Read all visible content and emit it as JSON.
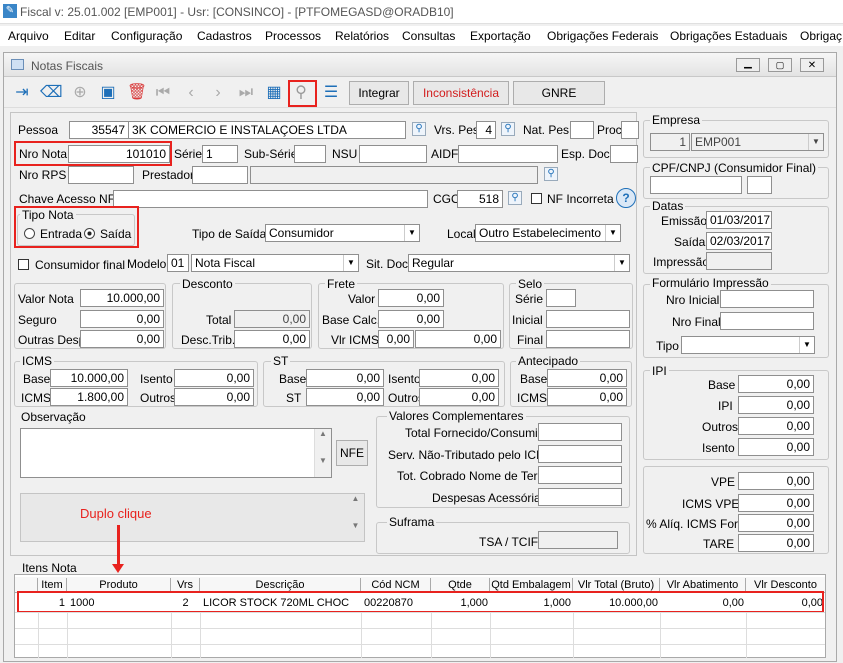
{
  "app_title": "Fiscal  v: 25.01.002   [EMP001] - Usr: [CONSINCO] - [PTFOMEGASD@ORADB10]",
  "menu": [
    "Arquivo",
    "Editar",
    "Configuração",
    "Cadastros",
    "Processos",
    "Relatórios",
    "Consultas",
    "Exportação",
    "Obrigações Federais",
    "Obrigações Estaduais",
    "Obrigaç"
  ],
  "window_title": "Notas Fiscais",
  "toolbar": {
    "integrar": "Integrar",
    "inconsistencia": "Inconsistência",
    "gnre": "GNRE"
  },
  "header": {
    "pessoa_label": "Pessoa",
    "pessoa_code": "35547",
    "pessoa_name": "3K COMERCIO E INSTALAÇOES LTDA",
    "vrs_pes_label": "Vrs. Pes",
    "vrs_pes": "4",
    "nat_pes_label": "Nat. Pes.",
    "proc_label": "Proc.",
    "nro_nota_label": "Nro Nota",
    "nro_nota": "101010",
    "serie_label": "Série",
    "serie": "1",
    "subserie_label": "Sub-Série",
    "nsu_label": "NSU",
    "aidf_label": "AIDF",
    "esp_doc_label": "Esp. Doc.",
    "nro_rps_label": "Nro RPS",
    "prestador_label": "Prestador",
    "chave_label": "Chave Acesso NFe",
    "cgo_label": "CGO",
    "cgo": "518",
    "nf_incorreta_label": "NF Incorreta",
    "tipo_nota_label": "Tipo Nota",
    "entrada": "Entrada",
    "saida": "Saída",
    "tipo_saida_label": "Tipo de Saída",
    "tipo_saida": "Consumidor",
    "local_label": "Local",
    "local": "Outro Estabelecimento",
    "consumidor_final_label": "Consumidor final",
    "modelo_label": "Modelo",
    "modelo_code": "01",
    "modelo": "Nota Fiscal",
    "sit_doc_label": "Sit. Doc.",
    "sit_doc": "Regular"
  },
  "valores": {
    "valor_nota_label": "Valor Nota",
    "valor_nota": "10.000,00",
    "seguro_label": "Seguro",
    "seguro": "0,00",
    "outras_desp_label": "Outras Desp.",
    "outras_desp": "0,00"
  },
  "desconto": {
    "title": "Desconto",
    "total_label": "Total",
    "total": "0,00",
    "desc_trib_label": "Desc.Trib.",
    "desc_trib": "0,00"
  },
  "frete": {
    "title": "Frete",
    "valor_label": "Valor",
    "valor": "0,00",
    "base_calc_label": "Base Calc.",
    "base_calc": "0,00",
    "vlr_icms_label": "Vlr ICMS",
    "vlr_icms_a": "0,00",
    "vlr_icms_b": "0,00"
  },
  "selo": {
    "title": "Selo",
    "serie_label": "Série",
    "inicial_label": "Inicial",
    "final_label": "Final"
  },
  "icms": {
    "title": "ICMS",
    "base_label": "Base",
    "base": "10.000,00",
    "isento_label": "Isento",
    "isento": "0,00",
    "icms_label": "ICMS",
    "icms": "1.800,00",
    "outros_label": "Outros",
    "outros": "0,00"
  },
  "st": {
    "title": "ST",
    "base_label": "Base",
    "base": "0,00",
    "isento_label": "Isento",
    "isento": "0,00",
    "st_label": "ST",
    "st": "0,00",
    "outros_label": "Outros",
    "outros": "0,00"
  },
  "antecipado": {
    "title": "Antecipado",
    "base_label": "Base",
    "base": "0,00",
    "icms_label": "ICMS",
    "icms": "0,00"
  },
  "observacao_label": "Observação",
  "nfe_button": "NFE",
  "valores_complementares": {
    "title": "Valores Complementares",
    "l1": "Total Fornecido/Consumido",
    "l2": "Serv. Não-Tributado pelo ICMS",
    "l3": "Tot. Cobrado Nome de Terc.",
    "l4": "Despesas Acessórias"
  },
  "suframa": {
    "title": "Suframa",
    "tsa_label": "TSA / TCIF"
  },
  "annotation": "Duplo clique",
  "empresa": {
    "title": "Empresa",
    "code": "1",
    "name": "EMP001"
  },
  "cpf_label": "CPF/CNPJ (Consumidor Final)",
  "datas": {
    "title": "Datas",
    "emissao_label": "Emissão",
    "emissao": "01/03/2017",
    "saida_label": "Saída",
    "saida": "02/03/2017",
    "impressao_label": "Impressão"
  },
  "formulario": {
    "title": "Formulário Impressão",
    "nro_inicial_label": "Nro Inicial",
    "nro_final_label": "Nro Final",
    "tipo_label": "Tipo"
  },
  "ipi": {
    "title": "IPI",
    "base_label": "Base",
    "base": "0,00",
    "ipi_label": "IPI",
    "ipi": "0,00",
    "outros_label": "Outros",
    "outros": "0,00",
    "isento_label": "Isento",
    "isento": "0,00"
  },
  "vpe": {
    "vpe_label": "VPE",
    "vpe": "0,00",
    "icms_vpe_label": "ICMS VPE",
    "icms_vpe": "0,00",
    "aliq_label": "% Alíq. ICMS Forn.",
    "aliq": "0,00",
    "tare_label": "TARE",
    "tare": "0,00"
  },
  "itens": {
    "title": "Itens Nota",
    "columns": [
      "Item",
      "Produto",
      "Vrs",
      "Descrição",
      "Cód NCM",
      "Qtde",
      "Qtd Embalagem",
      "Vlr Total (Bruto)",
      "Vlr Abatimento",
      "Vlr Desconto"
    ],
    "row": {
      "item": "1",
      "produto": "1000",
      "vrs": "2",
      "descricao": "LICOR STOCK 720ML CHOC",
      "ncm": "00220870",
      "qtde": "1,000",
      "qtd_emb": "1,000",
      "vlr_total": "10.000,00",
      "vlr_abat": "0,00",
      "vlr_desc": "0,00"
    }
  },
  "colors": {
    "highlight": "#e8221e",
    "toolbar_icon": "#1e6fb8",
    "delete_icon": "#d93a3a"
  }
}
